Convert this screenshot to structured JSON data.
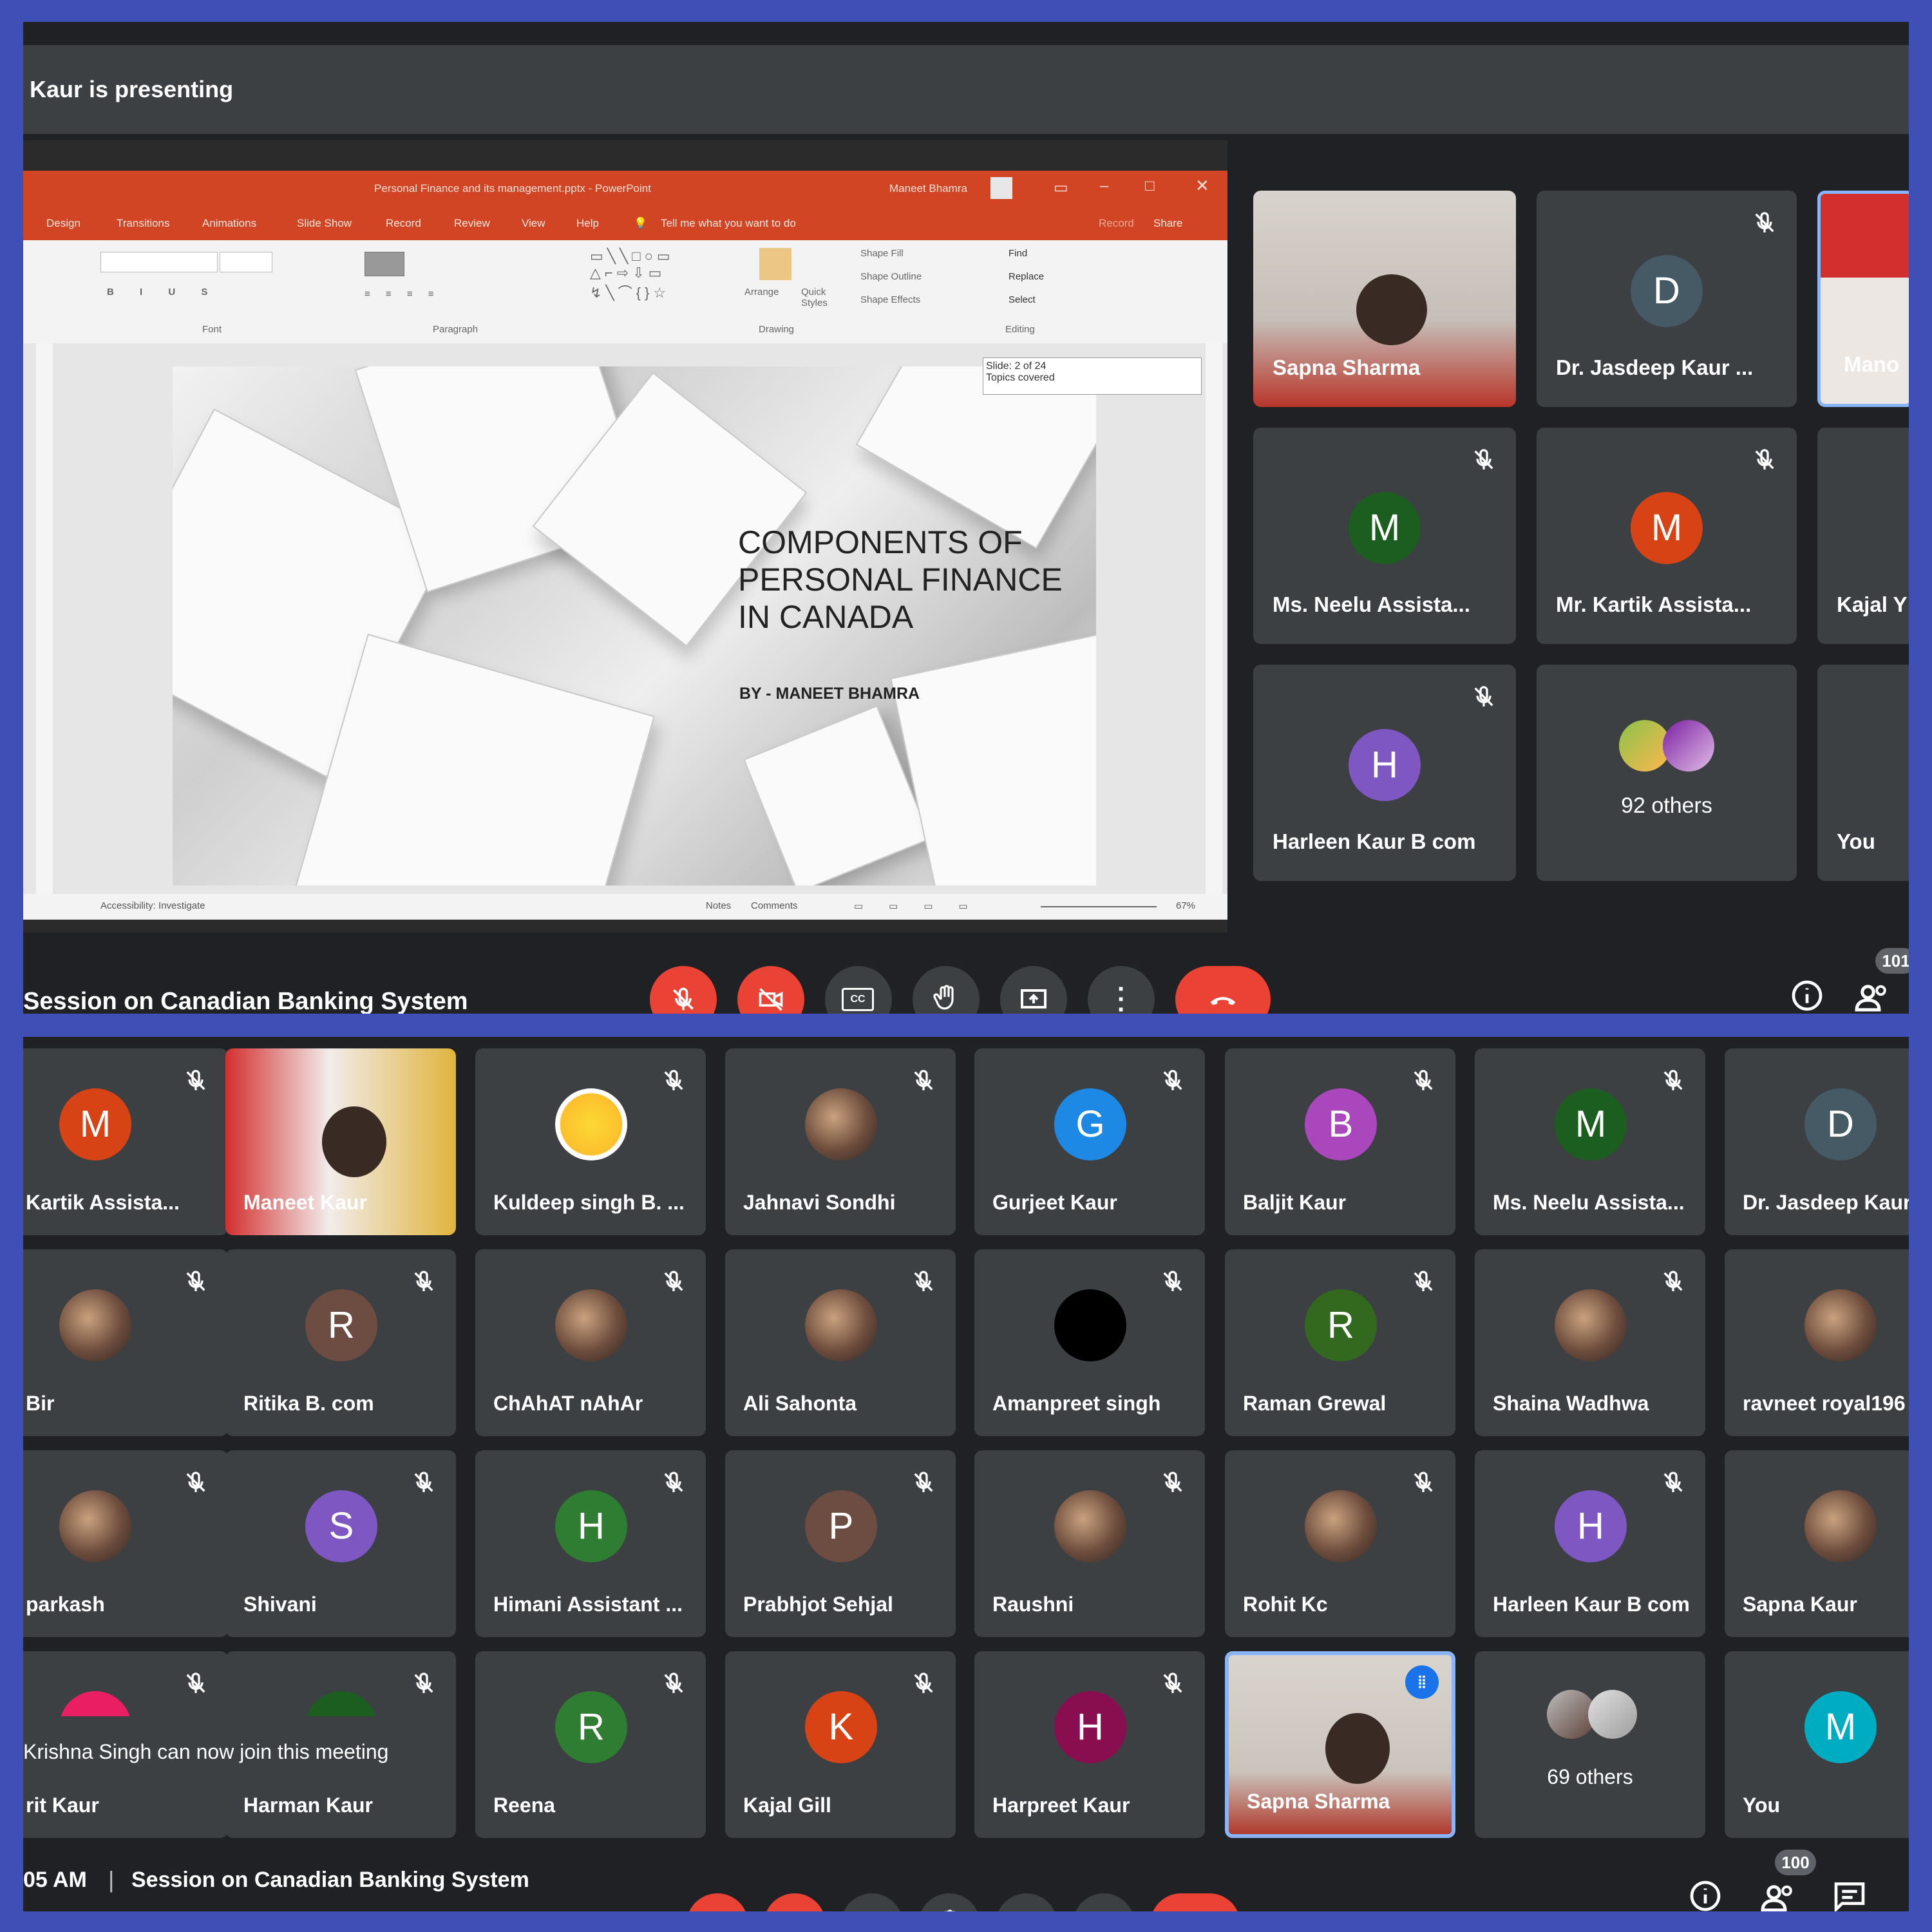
{
  "top": {
    "presenting_text": "Kaur is presenting",
    "ppt": {
      "title_bar": "Personal Finance and its management.pptx  -  PowerPoint",
      "user": "Maneet Bhamra",
      "tabs": [
        "Design",
        "Transitions",
        "Animations",
        "Slide Show",
        "Record",
        "Review",
        "View",
        "Help",
        "Tell me what you want to do"
      ],
      "record": "Record",
      "share": "Share",
      "ribbon_groups": [
        "Font",
        "Paragraph",
        "Drawing",
        "Editing"
      ],
      "editing": [
        "Find",
        "Replace",
        "Select"
      ],
      "arrange": "Arrange",
      "quick_styles": "Quick Styles",
      "shape_fill": "Shape Fill",
      "shape_outline": "Shape Outline",
      "shape_effects": "Shape Effects",
      "slide_tooltip": "Slide: 2 of 24\nTopics covered",
      "slide_title": "COMPONENTS OF PERSONAL FINANCE IN CANADA",
      "slide_subtitle": "BY - MANEET BHAMRA",
      "status": {
        "accessibility": "Accessibility: Investigate",
        "notes": "Notes",
        "comments": "Comments",
        "zoom": "67%"
      }
    },
    "tiles": [
      {
        "name": "Sapna Sharma",
        "type": "video"
      },
      {
        "name": "Dr. Jasdeep Kaur ...",
        "initial": "D",
        "color": "#455a64"
      },
      {
        "name": "Mano",
        "type": "video"
      },
      {
        "name": "Ms. Neelu Assista...",
        "initial": "M",
        "color": "#1b5e20"
      },
      {
        "name": "Mr. Kartik Assista...",
        "initial": "M",
        "color": "#d84315"
      },
      {
        "name": "Kajal Y"
      },
      {
        "name": "Harleen Kaur B com",
        "initial": "H",
        "color": "#7e57c2"
      },
      {
        "name": "92 others"
      },
      {
        "name": "You"
      }
    ],
    "meeting_title": "Session on Canadian Banking System",
    "participant_count": "101"
  },
  "bottom": {
    "rows": [
      [
        {
          "name": "Kartik Assista...",
          "initial": "M",
          "color": "#d84315"
        },
        {
          "name": "Maneet Kaur",
          "type": "video"
        },
        {
          "name": "Kuldeep singh B. ...",
          "type": "photo"
        },
        {
          "name": "Jahnavi Sondhi",
          "type": "photo"
        },
        {
          "name": "Gurjeet Kaur",
          "initial": "G",
          "color": "#1e88e5"
        },
        {
          "name": "Baljit Kaur",
          "initial": "B",
          "color": "#ab47bc"
        },
        {
          "name": "Ms. Neelu Assista...",
          "initial": "M",
          "color": "#1b5e20"
        },
        {
          "name": "Dr. Jasdeep Kaur",
          "initial": "D",
          "color": "#455a64"
        }
      ],
      [
        {
          "name": "Bir",
          "type": "photo"
        },
        {
          "name": "Ritika B. com",
          "initial": "R",
          "color": "#6d4c41"
        },
        {
          "name": "ChAhAT nAhAr",
          "type": "photo"
        },
        {
          "name": "Ali Sahonta",
          "type": "photo"
        },
        {
          "name": "Amanpreet singh",
          "type": "photo"
        },
        {
          "name": "Raman Grewal",
          "initial": "R",
          "color": "#33691e"
        },
        {
          "name": "Shaina Wadhwa",
          "type": "photo"
        },
        {
          "name": "ravneet royal196",
          "type": "photo"
        }
      ],
      [
        {
          "name": "parkash",
          "type": "photo"
        },
        {
          "name": "Shivani",
          "initial": "S",
          "color": "#7e57c2"
        },
        {
          "name": "Himani Assistant ...",
          "initial": "H",
          "color": "#2e7d32"
        },
        {
          "name": "Prabhjot Sehjal",
          "initial": "P",
          "color": "#6d4c41"
        },
        {
          "name": "Raushni",
          "type": "photo"
        },
        {
          "name": "Rohit Kc",
          "type": "photo"
        },
        {
          "name": "Harleen Kaur B com",
          "initial": "H",
          "color": "#7e57c2"
        },
        {
          "name": "Sapna Kaur",
          "type": "photo"
        }
      ],
      [
        {
          "name": "rit Kaur",
          "initial": "",
          "color": "#e91e63"
        },
        {
          "name": "Harman Kaur",
          "initial": "",
          "color": "#1b5e20"
        },
        {
          "name": "Reena",
          "initial": "R",
          "color": "#2e7d32"
        },
        {
          "name": "Kajal Gill",
          "initial": "K",
          "color": "#d84315"
        },
        {
          "name": "Harpreet Kaur",
          "initial": "H",
          "color": "#880e4f"
        },
        {
          "name": "Sapna Sharma",
          "type": "video"
        },
        {
          "name": "69 others"
        },
        {
          "name": "You",
          "initial": "M",
          "color": "#00acc1"
        }
      ]
    ],
    "toast": "Krishna Singh can now join this meeting",
    "time": "05 AM",
    "separator": "|",
    "meeting_title": "Session on Canadian Banking System",
    "participant_count": "100"
  },
  "colors": {
    "frame": "#3f4fb5",
    "bg": "#202124",
    "tile": "#3c4043",
    "red": "#ea4335",
    "speaking": "#8ab4f8"
  }
}
